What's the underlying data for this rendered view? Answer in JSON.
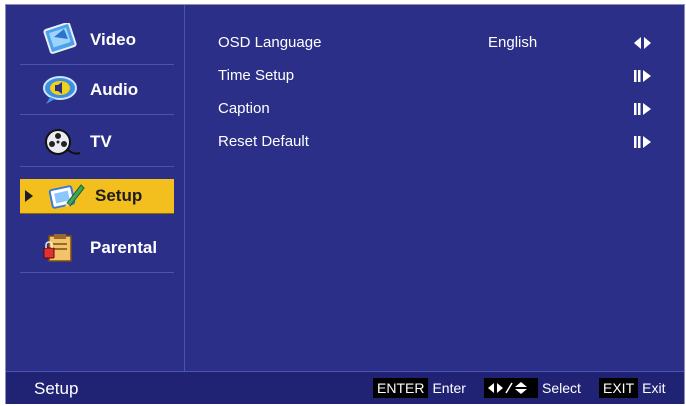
{
  "sidebar": {
    "items": [
      {
        "label": "Video",
        "icon": "video-icon",
        "selected": false
      },
      {
        "label": "Audio",
        "icon": "audio-icon",
        "selected": false
      },
      {
        "label": "TV",
        "icon": "tv-icon",
        "selected": false
      },
      {
        "label": "Setup",
        "icon": "setup-icon",
        "selected": true
      },
      {
        "label": "Parental",
        "icon": "parental-icon",
        "selected": false
      }
    ],
    "selected_color": "#f3bf1f"
  },
  "main": {
    "rows": [
      {
        "label": "OSD Language",
        "value": "English",
        "arrow": "left-right-arrow-icon"
      },
      {
        "label": "Time Setup",
        "value": "",
        "arrow": "enter-arrow-icon"
      },
      {
        "label": "Caption",
        "value": "",
        "arrow": "enter-arrow-icon"
      },
      {
        "label": "Reset Default",
        "value": "",
        "arrow": "enter-arrow-icon"
      }
    ]
  },
  "footer": {
    "title": "Setup",
    "hints": [
      {
        "key": "ENTER",
        "label": "Enter"
      },
      {
        "key": "",
        "key_icon": "left-right-up-down-icon",
        "label": "Select"
      },
      {
        "key": "EXIT",
        "label": "Exit"
      }
    ]
  },
  "colors": {
    "background": "#2b2f88",
    "footer": "#202373",
    "highlight": "#f3bf1f"
  }
}
